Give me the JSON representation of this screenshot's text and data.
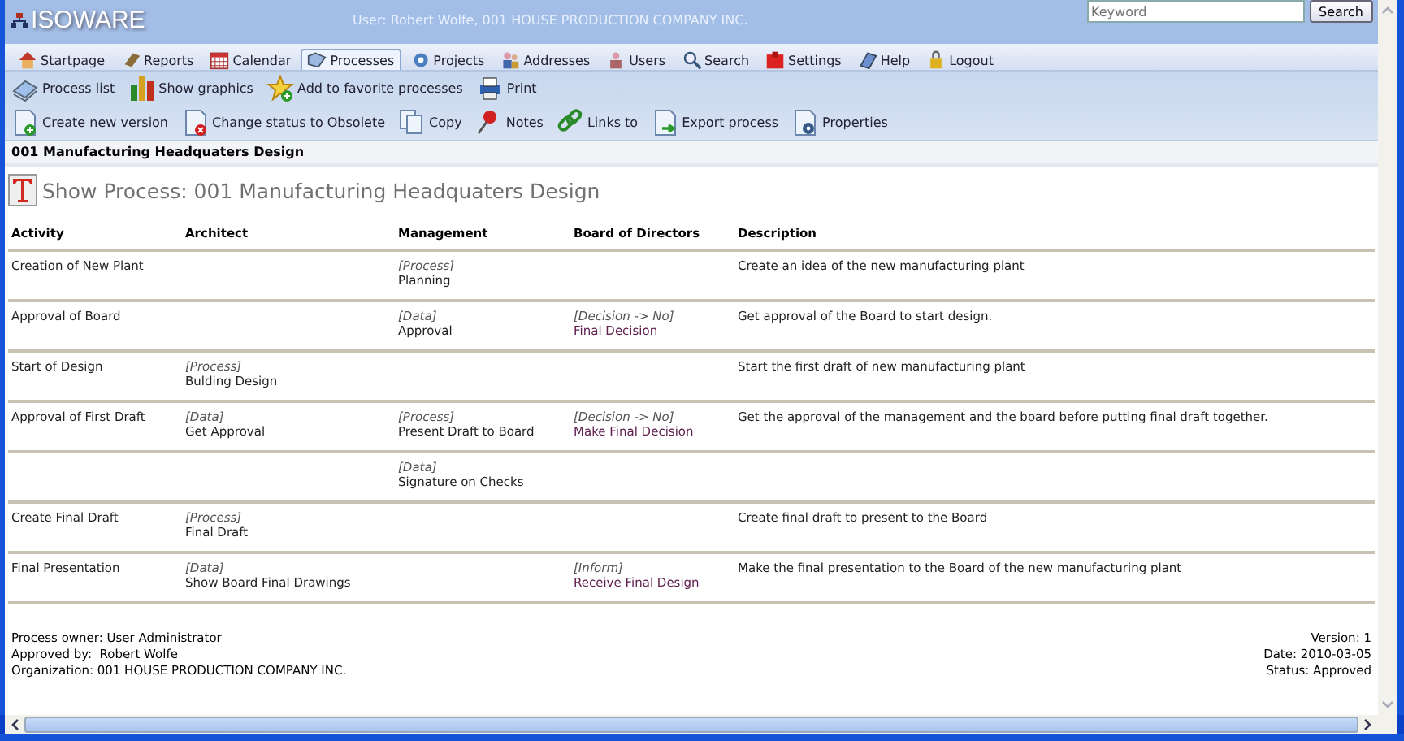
{
  "header": {
    "logo": "ISOWARE",
    "user": "User: Robert Wolfe, 001 HOUSE PRODUCTION COMPANY INC.",
    "search": {
      "placeholder": "Keyword"
    },
    "search_button": "Search"
  },
  "nav": [
    {
      "label": "Startpage",
      "selected": false
    },
    {
      "label": "Reports",
      "selected": false
    },
    {
      "label": "Calendar",
      "selected": false
    },
    {
      "label": "Processes",
      "selected": true
    },
    {
      "label": "Projects",
      "selected": false
    },
    {
      "label": "Addresses",
      "selected": false
    },
    {
      "label": "Users",
      "selected": false
    },
    {
      "label": "Search",
      "selected": false
    },
    {
      "label": "Settings",
      "selected": false
    },
    {
      "label": "Help",
      "selected": false
    },
    {
      "label": "Logout",
      "selected": false
    }
  ],
  "toolbar": [
    [
      "Process list",
      "Show graphics",
      "Add to favorite processes",
      "Print"
    ],
    [
      "Create new version",
      "Change status to Obsolete",
      "Copy",
      "Notes",
      "Links to",
      "Export process",
      "Properties"
    ]
  ],
  "title_bar": "001 Manufacturing Headquaters Design",
  "page_title": "Show Process: 001 Manufacturing Headquaters Design",
  "table": {
    "columns": [
      "Activity",
      "Architect",
      "Management",
      "Board of Directors",
      "Description"
    ],
    "rows": [
      {
        "cells": [
          "Creation of New Plant",
          "",
          {
            "type": "[Process]",
            "name": "Planning"
          },
          "",
          "Create an idea of the new manufacturing plant"
        ]
      },
      {
        "cells": [
          "Approval of Board",
          "",
          {
            "type": "[Data]",
            "name": "Approval"
          },
          {
            "type": "[Decision -> No]",
            "name": "Final Decision"
          },
          "Get approval of the Board to start design."
        ]
      },
      {
        "cells": [
          "Start of Design",
          {
            "type": "[Process]",
            "name": "Bulding Design"
          },
          "",
          "",
          "Start the first draft of new manufacturing plant"
        ]
      },
      {
        "cells": [
          "Approval of First Draft",
          {
            "type": "[Data]",
            "name": "Get Approval"
          },
          {
            "type": "[Process]",
            "name": "Present Draft to Board"
          },
          {
            "type": "[Decision -> No]",
            "name": "Make Final Decision"
          },
          "Get the approval of the management and the board before putting final draft together."
        ]
      },
      {
        "cells": [
          "",
          "",
          {
            "type": "[Data]",
            "name": "Signature on Checks"
          },
          "",
          ""
        ]
      },
      {
        "cells": [
          "Create Final Draft",
          {
            "type": "[Process]",
            "name": "Final Draft"
          },
          "",
          "",
          "Create final draft to present to the Board"
        ]
      },
      {
        "cells": [
          "Final Presentation",
          {
            "type": "[Data]",
            "name": "Show Board Final Drawings"
          },
          "",
          {
            "type": "[Inform]",
            "name": "Receive Final Design"
          },
          "Make the final presentation to the Board of the new manufacturing plant"
        ]
      }
    ]
  },
  "footer": {
    "left": [
      "Process owner: User Administrator",
      "Approved by:  Robert Wolfe",
      "Organization: 001 HOUSE PRODUCTION COMPANY INC."
    ],
    "right": [
      "Version: 1",
      "Date: 2010-03-05",
      "Status: Approved"
    ]
  }
}
